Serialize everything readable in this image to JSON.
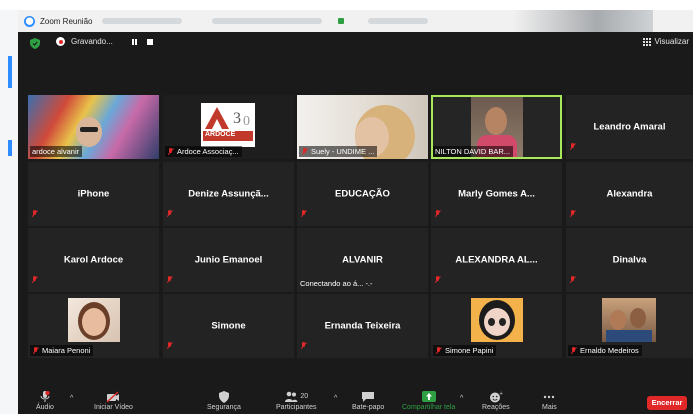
{
  "window": {
    "title": "Zoom Reunião"
  },
  "top_bar": {
    "recording_label": "Gravando...",
    "view_label": "Visualizar"
  },
  "participants": [
    {
      "name": "ardoce alvanir",
      "muted": false,
      "video": true
    },
    {
      "name": "Ardoce Associaç...",
      "muted": true,
      "video": true,
      "logo_text": "ARDOCE"
    },
    {
      "name": "Suely - UNDIME ...",
      "muted": true,
      "video": true
    },
    {
      "name": "NILTON DAVID BAR...",
      "muted": false,
      "video": true,
      "active_speaker": true
    },
    {
      "name": "Leandro Amaral",
      "muted": true,
      "video": false
    },
    {
      "name": "iPhone",
      "muted": true,
      "video": false
    },
    {
      "name": "Denize Assunçã...",
      "muted": true,
      "video": false
    },
    {
      "name": "EDUCAÇÃO",
      "muted": true,
      "video": false
    },
    {
      "name": "Marly Gomes A...",
      "muted": true,
      "video": false
    },
    {
      "name": "Alexandra",
      "muted": true,
      "video": false
    },
    {
      "name": "Karol Ardoce",
      "muted": true,
      "video": false
    },
    {
      "name": "Junio Emanoel",
      "muted": true,
      "video": false
    },
    {
      "name": "ALVANIR",
      "muted": false,
      "video": false,
      "status": "Conectando ao á... -.-"
    },
    {
      "name": "ALEXANDRA AL...",
      "muted": true,
      "video": false
    },
    {
      "name": "Dinalva",
      "muted": true,
      "video": false
    },
    {
      "name": "Maiara Penoni",
      "muted": true,
      "video": false,
      "avatar": true
    },
    {
      "name": "Simone",
      "muted": true,
      "video": false
    },
    {
      "name": "Ernanda Teixeira",
      "muted": true,
      "video": false
    },
    {
      "name": "Simone Papini",
      "muted": true,
      "video": false,
      "avatar": true
    },
    {
      "name": "Ernaldo Medeiros",
      "muted": true,
      "video": false,
      "avatar": true
    }
  ],
  "toolbar": {
    "audio": "Áudio",
    "start_video": "Iniciar Vídeo",
    "security": "Segurança",
    "participants": "Participantes",
    "participants_count": "20",
    "chat": "Bate-papo",
    "share_screen": "Compartilhar tela",
    "reactions": "Reações",
    "more": "Mais",
    "end": "Encerrar"
  },
  "colors": {
    "active_speaker_border": "#a8e85a",
    "share_green": "#2ea043",
    "end_red": "#e02828",
    "muted_red": "#e02828"
  }
}
